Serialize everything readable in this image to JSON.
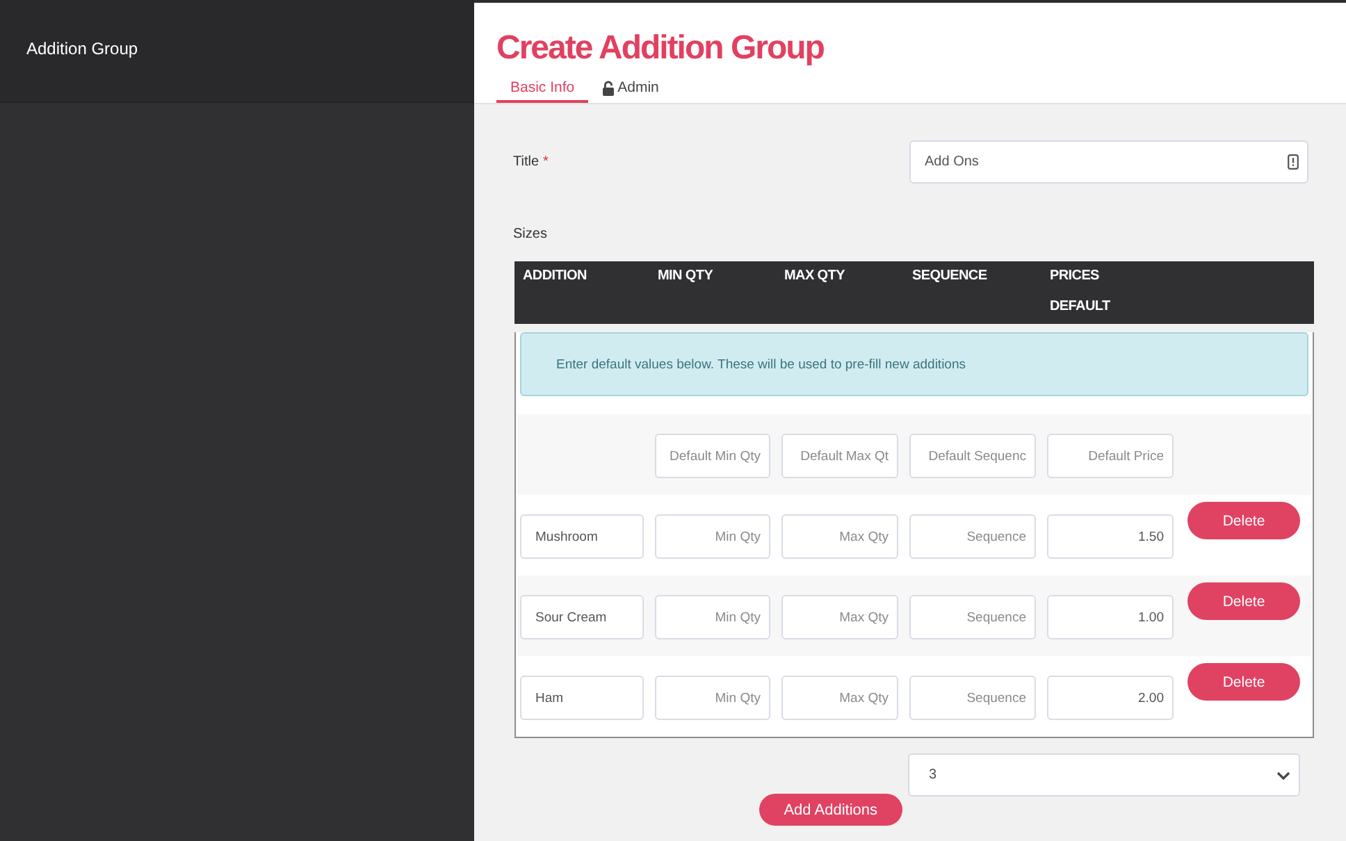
{
  "sidebar": {
    "title": "Addition Group"
  },
  "header": {
    "title": "Create Addition Group",
    "tabs": [
      {
        "label": "Basic Info",
        "selected": true,
        "kind": "text"
      },
      {
        "label": "Admin",
        "selected": false,
        "kind": "locked"
      }
    ]
  },
  "form": {
    "title_field": {
      "label": "Title",
      "required_mark": "*",
      "value": "Add Ons"
    },
    "sizes_label": "Sizes"
  },
  "table": {
    "columns": [
      {
        "label": "ADDITION"
      },
      {
        "label": "MIN QTY"
      },
      {
        "label": "MAX QTY"
      },
      {
        "label": "SEQUENCE"
      },
      {
        "label": "PRICES",
        "sub_label": "DEFAULT"
      }
    ],
    "notice": "Enter default values below. These will be used to pre-fill new additions",
    "defaults": [
      {
        "placeholder": "Default Min Qty"
      },
      {
        "placeholder": "Default Max Qt"
      },
      {
        "placeholder": "Default Sequenc"
      },
      {
        "placeholder": "Default Price"
      }
    ],
    "rows": [
      {
        "addition": {
          "value": "Mushroom"
        },
        "min_qty": {
          "placeholder": "Min Qty"
        },
        "max_qty": {
          "placeholder": "Max Qty"
        },
        "sequence": {
          "placeholder": "Sequence"
        },
        "price": {
          "value": "1.50"
        },
        "delete_button": "Delete"
      },
      {
        "addition": {
          "value": "Sour Cream"
        },
        "min_qty": {
          "placeholder": "Min Qty"
        },
        "max_qty": {
          "placeholder": "Max Qty"
        },
        "sequence": {
          "placeholder": "Sequence"
        },
        "price": {
          "value": "1.00"
        },
        "delete_button": "Delete"
      },
      {
        "addition": {
          "value": "Ham"
        },
        "min_qty": {
          "placeholder": "Min Qty"
        },
        "max_qty": {
          "placeholder": "Max Qty"
        },
        "sequence": {
          "placeholder": "Sequence"
        },
        "price": {
          "value": "2.00"
        },
        "delete_button": "Delete"
      }
    ]
  },
  "count_select": {
    "value": "3"
  },
  "add_button": "Add Additions"
}
